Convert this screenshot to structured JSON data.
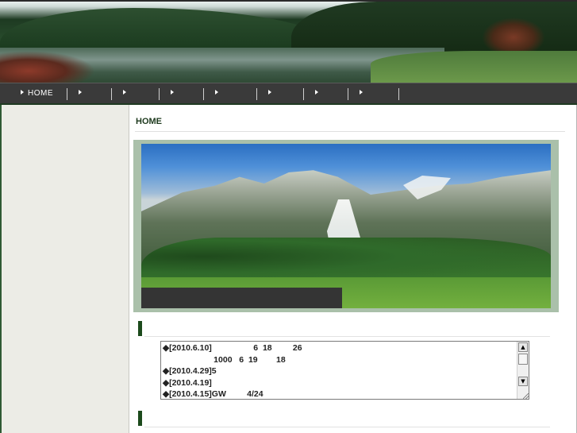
{
  "nav": {
    "items": [
      {
        "label": "HOME",
        "icon": "triangle-right-icon"
      },
      {
        "label": "",
        "icon": "triangle-right-icon"
      },
      {
        "label": "",
        "icon": "triangle-right-icon"
      },
      {
        "label": "",
        "icon": "triangle-right-icon"
      },
      {
        "label": "",
        "icon": "triangle-right-icon"
      },
      {
        "label": "",
        "icon": "triangle-right-icon"
      },
      {
        "label": "",
        "icon": "triangle-right-icon"
      },
      {
        "label": "",
        "icon": "triangle-right-icon"
      }
    ]
  },
  "main": {
    "page_title": "HOME",
    "caption": ""
  },
  "news": {
    "lines": [
      "◆[2010.6.10]                  6  18         26",
      "                      1000   6  19        18",
      "◆[2010.4.29]5",
      "◆[2010.4.19]",
      "◆[2010.4.15]GW         4/24"
    ],
    "scroll_up": "▲",
    "scroll_down": "▼"
  },
  "colors": {
    "nav_bg": "#3a3a3a",
    "sidebar_bg": "#ecece6",
    "accent_green": "#1c4a1c",
    "photo_frame": "#aac0aa"
  }
}
